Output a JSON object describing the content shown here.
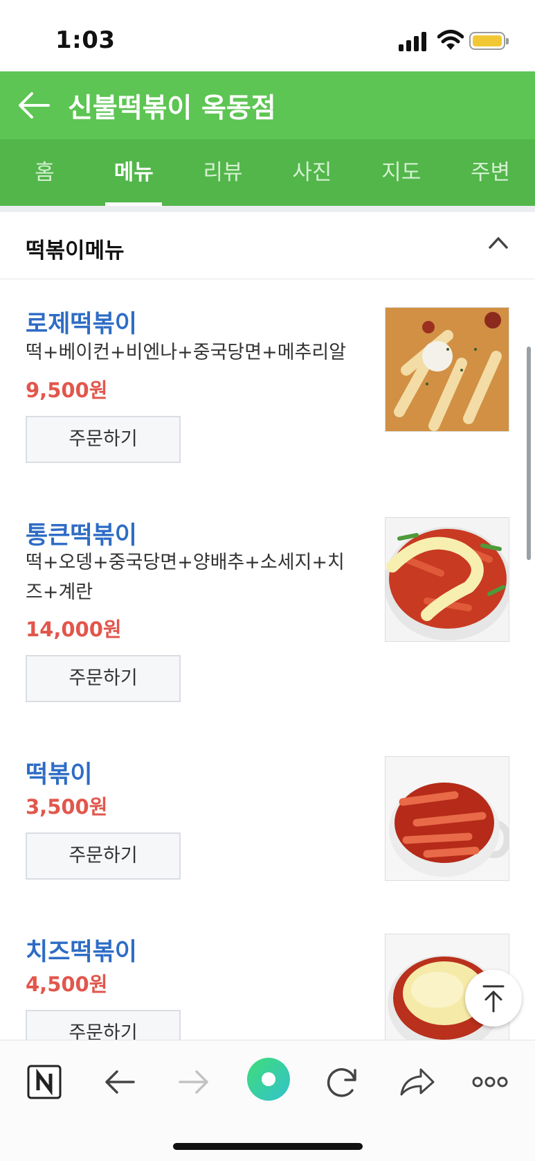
{
  "status": {
    "time": "1:03"
  },
  "header": {
    "title": "신불떡볶이 옥동점"
  },
  "tabs": [
    {
      "label": "홈",
      "active": false
    },
    {
      "label": "메뉴",
      "active": true
    },
    {
      "label": "리뷰",
      "active": false
    },
    {
      "label": "사진",
      "active": false
    },
    {
      "label": "지도",
      "active": false
    },
    {
      "label": "주변",
      "active": false
    }
  ],
  "section": {
    "title": "떡볶이메뉴",
    "expanded": true
  },
  "menu": [
    {
      "name": "로제떡볶이",
      "desc": "떡+베이컨+비엔나+중국당면+메추리알",
      "price": "9,500원",
      "order": "주문하기"
    },
    {
      "name": "통큰떡볶이",
      "desc": "떡+오뎅+중국당면+양배추+소세지+치즈+계란",
      "price": "14,000원",
      "order": "주문하기"
    },
    {
      "name": "떡볶이",
      "desc": "",
      "price": "3,500원",
      "order": "주문하기"
    },
    {
      "name": "치즈떡볶이",
      "desc": "",
      "price": "4,500원",
      "order": "주문하기"
    }
  ],
  "colors": {
    "header_green": "#5dc553",
    "tab_green": "#52b64a",
    "name_blue": "#2e6cc5",
    "price_red": "#e2564c"
  },
  "icons": [
    "back-arrow-icon",
    "chevron-up-icon",
    "arrow-up-to-top-icon",
    "naver-n-icon",
    "browser-back-icon",
    "browser-forward-icon",
    "green-dot-icon",
    "refresh-icon",
    "share-icon",
    "more-icon"
  ]
}
